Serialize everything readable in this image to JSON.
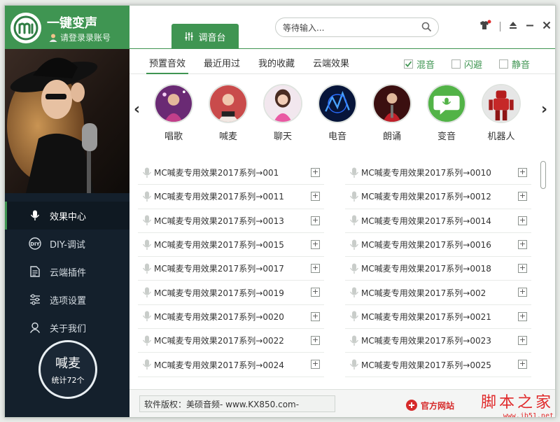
{
  "app": {
    "title": "一键变声",
    "login": "请登录录账号"
  },
  "header": {
    "tab_label": "调音台",
    "search_placeholder": "等待输入..."
  },
  "sidebar": {
    "items": [
      {
        "label": "效果中心",
        "icon": "mic-icon"
      },
      {
        "label": "DIY-调试",
        "icon": "diy-icon"
      },
      {
        "label": "云端插件",
        "icon": "document-icon"
      },
      {
        "label": "选项设置",
        "icon": "sliders-icon"
      },
      {
        "label": "关于我们",
        "icon": "user-icon"
      }
    ],
    "counter_title": "喊麦",
    "counter_sub": "统计72个"
  },
  "subtabs": [
    "预置音效",
    "最近用过",
    "我的收藏",
    "云端效果"
  ],
  "options": [
    {
      "label": "混音",
      "checked": true
    },
    {
      "label": "闪避",
      "checked": false
    },
    {
      "label": "静音",
      "checked": false
    }
  ],
  "categories": [
    "唱歌",
    "喊麦",
    "聊天",
    "电音",
    "朗诵",
    "变音",
    "机器人"
  ],
  "list": {
    "left": [
      "MC喊麦专用效果2017系列→001",
      "MC喊麦专用效果2017系列→0011",
      "MC喊麦专用效果2017系列→0013",
      "MC喊麦专用效果2017系列→0015",
      "MC喊麦专用效果2017系列→0017",
      "MC喊麦专用效果2017系列→0019",
      "MC喊麦专用效果2017系列→0020",
      "MC喊麦专用效果2017系列→0022",
      "MC喊麦专用效果2017系列→0024"
    ],
    "right": [
      "MC喊麦专用效果2017系列→0010",
      "MC喊麦专用效果2017系列→0012",
      "MC喊麦专用效果2017系列→0014",
      "MC喊麦专用效果2017系列→0016",
      "MC喊麦专用效果2017系列→0018",
      "MC喊麦专用效果2017系列→002",
      "MC喊麦专用效果2017系列→0021",
      "MC喊麦专用效果2017系列→0023",
      "MC喊麦专用效果2017系列→0025"
    ]
  },
  "footer": {
    "copyright": "软件版权：美硕音频- www.KX850.com-",
    "official_site": "官方网站",
    "watermark_big": "脚本之家",
    "watermark_small": "www.jb51.net"
  },
  "colors": {
    "accent": "#3f9552",
    "sidebar_bg": "#14202c",
    "watermark": "#e0292a"
  }
}
